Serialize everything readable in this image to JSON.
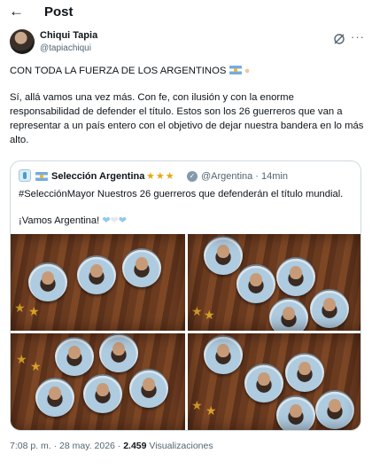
{
  "header": {
    "back_icon": "arrow-left-icon",
    "title": "Post"
  },
  "author": {
    "name": "Chiqui Tapia",
    "handle": "@tapiachiqui"
  },
  "tweet": {
    "line1": "CON TODA LA FUERZA DE LOS ARGENTINOS",
    "body": "Sí, allá vamos una vez más. Con fe, con ilusión y con la enorme responsabilidad de defender el título. Estos son los 26 guerreros que van a representar a un país entero con el objetivo de dejar nuestra bandera en lo más alto."
  },
  "quote": {
    "name": "Selección Argentina",
    "stars": "★★★",
    "handle": "@Argentina · 14min",
    "text": "#SelecciónMayor Nuestros 26 guerreros que defenderán el título mundial.",
    "text2": "¡Vamos Argentina!"
  },
  "meta": {
    "time": "7:08 p. m. · 28 may. 2026 · ",
    "views": "2.459",
    "views_label": " Visualizaciones"
  },
  "colors": {
    "text": "#0f1419",
    "muted": "#536471",
    "border": "#cfd9de",
    "star": "#e8a90b"
  }
}
